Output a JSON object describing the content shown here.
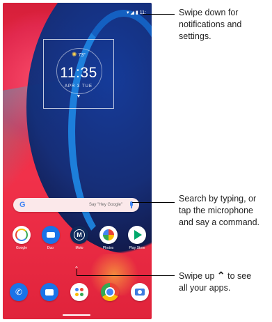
{
  "status_bar": {
    "time": "11:"
  },
  "clock_widget": {
    "weather": "73°",
    "time": "11:35",
    "date": "APR 3 TUE"
  },
  "search_bar": {
    "logo": "G",
    "hint": "Say \"Hey Google\""
  },
  "apps": [
    {
      "label": "Google",
      "icon": "google-folder-icon"
    },
    {
      "label": "Duo",
      "icon": "duo-icon"
    },
    {
      "label": "Moto",
      "icon": "moto-icon"
    },
    {
      "label": "Photos",
      "icon": "photos-icon"
    },
    {
      "label": "Play Store",
      "icon": "play-store-icon"
    }
  ],
  "dock": [
    {
      "icon": "phone-icon"
    },
    {
      "icon": "messages-icon"
    },
    {
      "icon": "assistant-icon"
    },
    {
      "icon": "chrome-icon"
    },
    {
      "icon": "camera-icon"
    }
  ],
  "callouts": {
    "notifications": "Swipe down for\nnotifications and\nsettings.",
    "search": "Search by typing, or\ntap the microphone\nand say a command.",
    "apps_prefix": "Swipe up",
    "apps_suffix": " to see\nall your apps."
  },
  "colors": {
    "google_blue": "#4285f4",
    "google_red": "#ea4335",
    "google_yellow": "#fbbc05",
    "google_green": "#34a853"
  }
}
